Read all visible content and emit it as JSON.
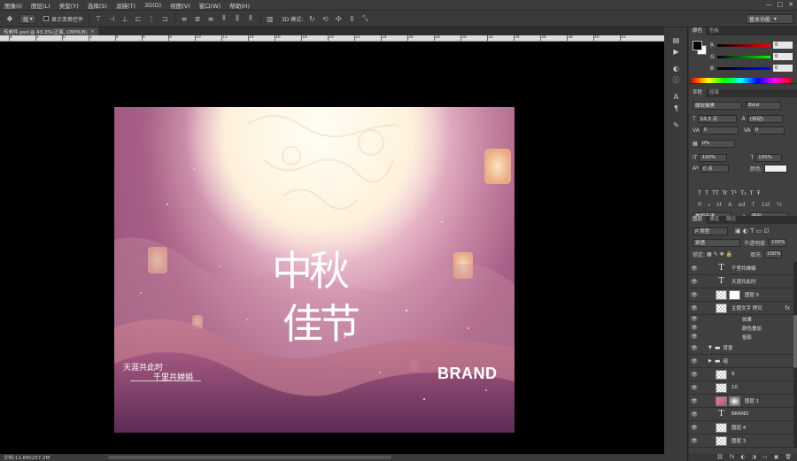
{
  "menubar": {
    "items": [
      "图像(I)",
      "图层(L)",
      "类型(Y)",
      "选择(S)",
      "滤镜(T)",
      "3D(D)",
      "视图(V)",
      "窗口(W)",
      "帮助(H)"
    ],
    "window_controls": [
      "—",
      "□",
      "✕"
    ]
  },
  "optionsbar": {
    "tool_select": "组",
    "show_transform_label": "显示变换控件",
    "mode_3d_label": "3D 模式:",
    "workspace": "基本功能"
  },
  "document": {
    "tab_title": "传邮件.psd @ 43.3%(正面, CMYK/8)",
    "ruler_ticks": [
      "4",
      "2",
      "0",
      "2",
      "4",
      "6",
      "8",
      "10",
      "12",
      "14",
      "16",
      "18",
      "20",
      "22",
      "24",
      "26",
      "28",
      "30",
      "32",
      "34",
      "36",
      "38",
      "40",
      "42"
    ],
    "status": "文档:11.6M/257.2M"
  },
  "artwork": {
    "title_line1": "中秋",
    "title_line2": "佳节",
    "poem_line1": "天涯共此时",
    "poem_line2": "千里共婵娟",
    "brand": "BRAND"
  },
  "color_panel": {
    "tabs": [
      "颜色",
      "色板"
    ],
    "channels": [
      {
        "label": "R",
        "value": "0"
      },
      {
        "label": "G",
        "value": "0"
      },
      {
        "label": "B",
        "value": "0"
      }
    ]
  },
  "character_panel": {
    "tabs": [
      "字符",
      "段落"
    ],
    "font_family": "微软雅黑",
    "font_style": "Bold",
    "font_size": "14.3 点",
    "leading": "(自动)",
    "kerning": "0",
    "tracking": "0",
    "tsume": "0%",
    "vertical_scale": "100%",
    "horizontal_scale": "100%",
    "baseline_shift": "0 点",
    "color_label": "颜色:",
    "type_styles": [
      "T",
      "T",
      "TT",
      "Tr",
      "T¹",
      "T₁",
      "T",
      "Ŧ"
    ],
    "opentype": [
      "fi",
      "ℴ",
      "st",
      "A",
      "ad",
      "T",
      "1st",
      "½"
    ],
    "language": "美国英语",
    "antialias": "犀利"
  },
  "layers_panel": {
    "tabs": [
      "图层",
      "通道",
      "路径"
    ],
    "filter_kind": "类型",
    "blend_mode": "穿透",
    "opacity_label": "不透明度:",
    "opacity": "100%",
    "lock_label": "锁定:",
    "fill_label": "填充:",
    "fill": "100%",
    "layers": [
      {
        "type": "text",
        "name": "千里共婵娟"
      },
      {
        "type": "text",
        "name": "天涯共此时"
      },
      {
        "type": "image-mask",
        "name": "图层 5"
      },
      {
        "type": "smart",
        "name": "主题文字 拷贝",
        "fx": "fx"
      },
      {
        "type": "sub",
        "name": "效果"
      },
      {
        "type": "sub",
        "name": "颜色叠加"
      },
      {
        "type": "sub",
        "name": "投影"
      },
      {
        "type": "group-open",
        "name": "背景"
      },
      {
        "type": "group",
        "name": "组"
      },
      {
        "type": "image",
        "name": "9"
      },
      {
        "type": "image",
        "name": "10"
      },
      {
        "type": "image-mask",
        "name": "图层 1"
      },
      {
        "type": "text",
        "name": "BRAND"
      },
      {
        "type": "image",
        "name": "图层 4"
      },
      {
        "type": "image",
        "name": "图层 3"
      }
    ],
    "bottom_icons": [
      "⛓",
      "fx",
      "◐",
      "◑",
      "▭",
      "▣",
      "🗑"
    ]
  },
  "colors": {
    "accent_selected": "#505a66",
    "brand_text": "#ffffff"
  }
}
